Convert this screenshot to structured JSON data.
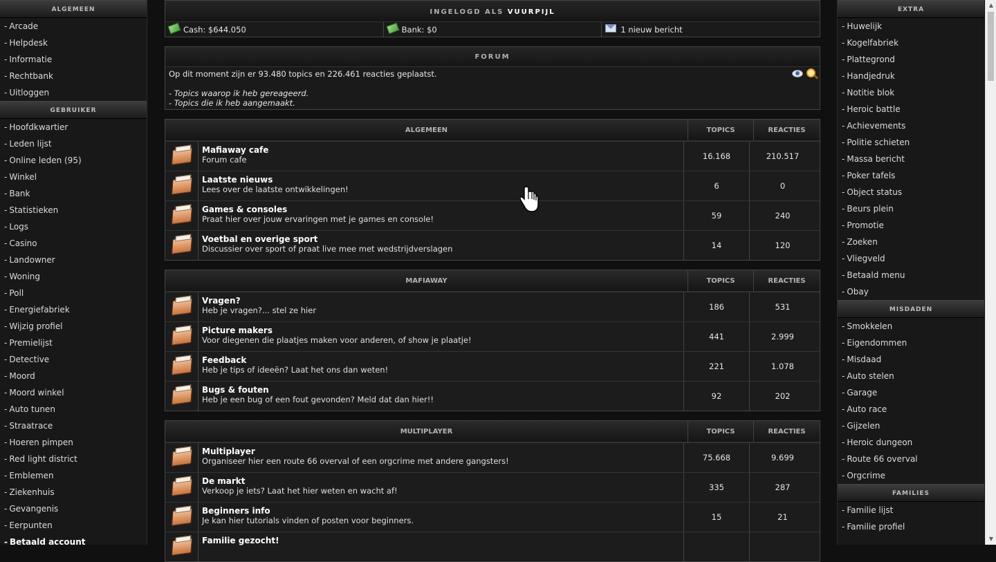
{
  "left_sidebar": {
    "sections": [
      {
        "title": "ALGEMEEN",
        "items": [
          "Arcade",
          "Helpdesk",
          "Informatie",
          "Rechtbank",
          "Uitloggen"
        ]
      },
      {
        "title": "GEBRUIKER",
        "items": [
          "Hoofdkwartier",
          "Leden lijst",
          "Online leden (95)",
          "Winkel",
          "Bank",
          "Statistieken",
          "Logs",
          "Casino",
          "Landowner",
          "Woning",
          "Poll",
          "Energiefabriek",
          "Wijzig profiel",
          "Premielijst",
          "Detective",
          "Moord",
          "Moord winkel",
          "Auto tunen",
          "Straatrace",
          "Hoeren pimpen",
          "Red light district",
          "Emblemen",
          "Ziekenhuis",
          "Gevangenis",
          "Eerpunten"
        ]
      }
    ],
    "extra_item": "Betaald account"
  },
  "right_sidebar": {
    "sections": [
      {
        "title": "EXTRA",
        "items": [
          "Huwelijk",
          "Kogelfabriek",
          "Plattegrond",
          "Handjedruk",
          "Notitie blok",
          "Heroic battle",
          "Achievements",
          "Politie schieten",
          "Massa bericht",
          "Poker tafels",
          "Object status",
          "Beurs plein",
          "Promotie",
          "Zoeken",
          "Vliegveld",
          "Betaald menu",
          "Obay"
        ]
      },
      {
        "title": "MISDADEN",
        "items": [
          "Smokkelen",
          "Eigendommen",
          "Misdaad",
          "Auto stelen",
          "Garage",
          "Auto race",
          "Gijzelen",
          "Heroic dungeon",
          "Route 66 overval",
          "Orgcrime"
        ]
      },
      {
        "title": "FAMILIES",
        "items": [
          "Familie lijst",
          "Familie profiel"
        ]
      }
    ]
  },
  "status": {
    "logged_in_prefix": "INGELOGD ALS",
    "username": "VUURPIJL",
    "cash": "Cash: $644.050",
    "bank": "Bank: $0",
    "messages": "1 nieuw bericht"
  },
  "forum": {
    "title": "FORUM",
    "summary": "Op dit moment zijn er 93.480 topics en 226.461 reacties geplaatst.",
    "link_replied": "- Topics waarop ik heb gereageerd.",
    "link_created": "- Topics die ik heb aangemaakt."
  },
  "columns": {
    "topics": "TOPICS",
    "reacties": "REACTIES"
  },
  "categories": [
    {
      "name": "ALGEMEEN",
      "forums": [
        {
          "title": "Mafiaway cafe",
          "desc": "Forum cafe",
          "topics": "16.168",
          "reacties": "210.517"
        },
        {
          "title": "Laatste nieuws",
          "desc": "Lees over de laatste ontwikkelingen!",
          "topics": "6",
          "reacties": "0"
        },
        {
          "title": "Games & consoles",
          "desc": "Praat hier over jouw ervaringen met je games en console!",
          "topics": "59",
          "reacties": "240"
        },
        {
          "title": "Voetbal en overige sport",
          "desc": "Discussier over sport of praat live mee met wedstrijdverslagen",
          "topics": "14",
          "reacties": "120"
        }
      ]
    },
    {
      "name": "MAFIAWAY",
      "forums": [
        {
          "title": "Vragen?",
          "desc": "Heb je vragen?... stel ze hier",
          "topics": "186",
          "reacties": "531"
        },
        {
          "title": "Picture makers",
          "desc": "Voor diegenen die plaatjes maken voor anderen, of show je plaatje!",
          "topics": "441",
          "reacties": "2.999"
        },
        {
          "title": "Feedback",
          "desc": "Heb je tips of ideeën? Laat het ons dan weten!",
          "topics": "221",
          "reacties": "1.078"
        },
        {
          "title": "Bugs & fouten",
          "desc": "Heb je een bug of een fout gevonden? Meld dat dan hier!!",
          "topics": "92",
          "reacties": "202"
        }
      ]
    },
    {
      "name": "MULTIPLAYER",
      "forums": [
        {
          "title": "Multiplayer",
          "desc": "Organiseer hier een route 66 overval of een orgcrime met andere gangsters!",
          "topics": "75.668",
          "reacties": "9.699"
        },
        {
          "title": "De markt",
          "desc": "Verkoop je iets? Laat het hier weten en wacht af!",
          "topics": "335",
          "reacties": "287"
        },
        {
          "title": "Beginners info",
          "desc": "Je kan hier tutorials vinden of posten voor beginners.",
          "topics": "15",
          "reacties": "21"
        },
        {
          "title": "Familie gezocht!",
          "desc": "",
          "topics": "",
          "reacties": ""
        }
      ]
    }
  ]
}
